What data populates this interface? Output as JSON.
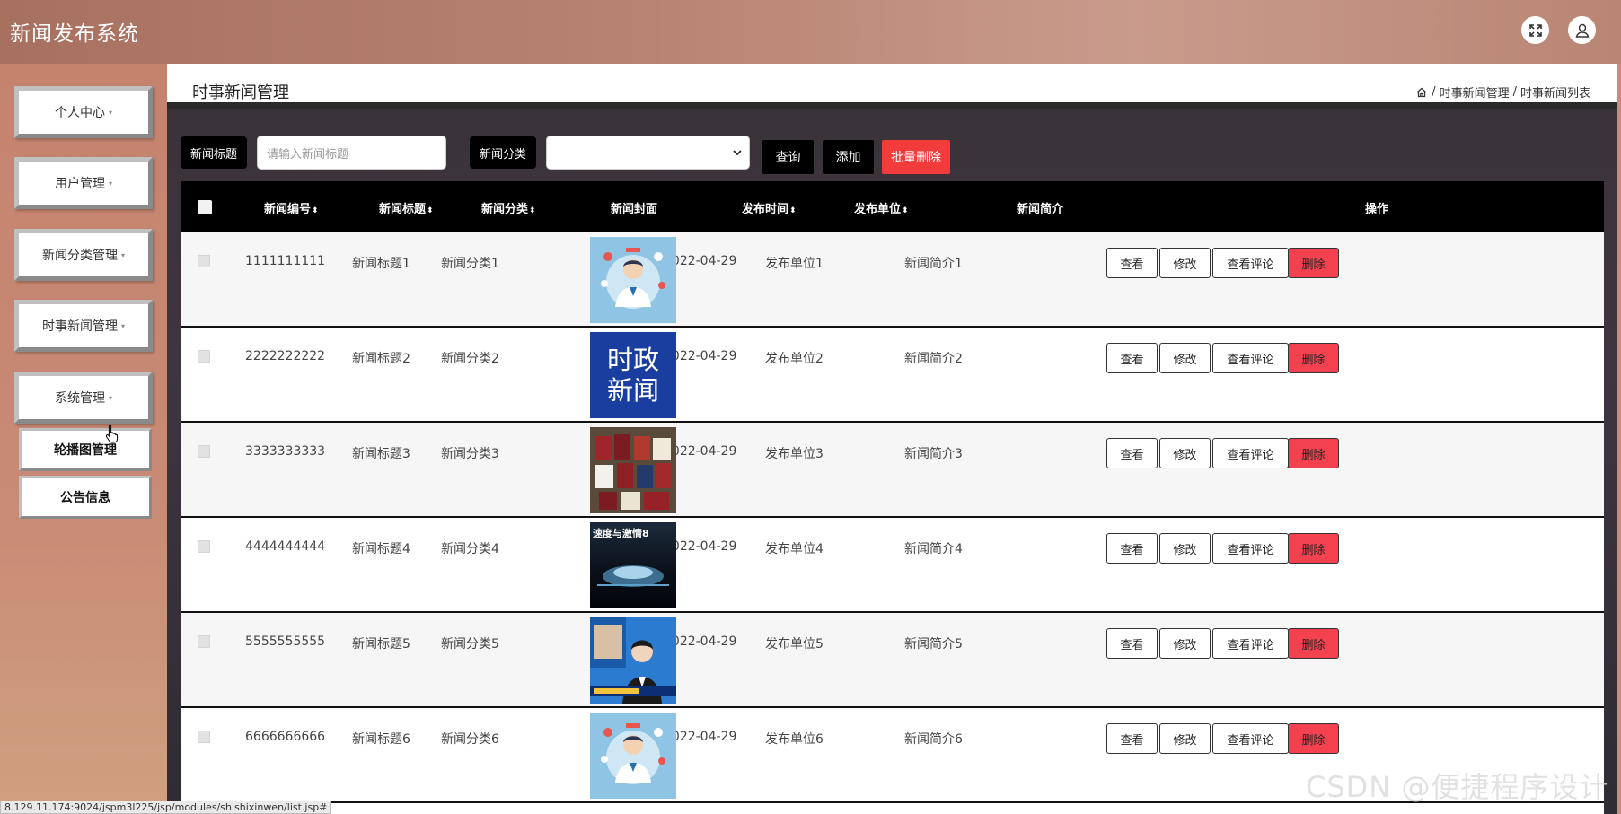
{
  "app": {
    "title": "新闻发布系统"
  },
  "sidebar": {
    "items": [
      {
        "label": "个人中心"
      },
      {
        "label": "用户管理"
      },
      {
        "label": "新闻分类管理"
      },
      {
        "label": "时事新闻管理"
      },
      {
        "label": "系统管理"
      }
    ],
    "sub_items": [
      {
        "label": "轮播图管理"
      },
      {
        "label": "公告信息"
      }
    ]
  },
  "page": {
    "title": "时事新闻管理",
    "breadcrumb": [
      "时事新闻管理",
      "时事新闻列表"
    ],
    "breadcrumb_sep": "/"
  },
  "filter": {
    "title_label": "新闻标题",
    "title_placeholder": "请输入新闻标题",
    "category_label": "新闻分类",
    "category_value": "",
    "query_button": "查询",
    "add_button": "添加",
    "batch_delete_button": "批量删除"
  },
  "table": {
    "headers": {
      "id": "新闻编号",
      "title": "新闻标题",
      "category": "新闻分类",
      "cover": "新闻封面",
      "time": "发布时间",
      "unit": "发布单位",
      "summary": "新闻简介",
      "actions": "操作"
    },
    "sort_glyph": "⬍",
    "actions": {
      "view": "查看",
      "edit": "修改",
      "comments": "查看评论",
      "delete": "删除"
    },
    "rows": [
      {
        "id": "1111111111",
        "title": "新闻标题1",
        "category": "新闻分类1",
        "time": "2022-04-29",
        "unit": "发布单位1",
        "summary": "新闻简介1",
        "cover": "doctor"
      },
      {
        "id": "2222222222",
        "title": "新闻标题2",
        "category": "新闻分类2",
        "time": "2022-04-29",
        "unit": "发布单位2",
        "summary": "新闻简介2",
        "cover": "politics",
        "cover_text": [
          "时政",
          "新闻"
        ]
      },
      {
        "id": "3333333333",
        "title": "新闻标题3",
        "category": "新闻分类3",
        "time": "2022-04-29",
        "unit": "发布单位3",
        "summary": "新闻简介3",
        "cover": "books"
      },
      {
        "id": "4444444444",
        "title": "新闻标题4",
        "category": "新闻分类4",
        "time": "2022-04-29",
        "unit": "发布单位4",
        "summary": "新闻简介4",
        "cover": "movie",
        "cover_text": [
          "速度与激情8"
        ]
      },
      {
        "id": "5555555555",
        "title": "新闻标题5",
        "category": "新闻分类5",
        "time": "2022-04-29",
        "unit": "发布单位5",
        "summary": "新闻简介5",
        "cover": "anchor"
      },
      {
        "id": "6666666666",
        "title": "新闻标题6",
        "category": "新闻分类6",
        "time": "2022-04-29",
        "unit": "发布单位6",
        "summary": "新闻简介6",
        "cover": "doctor"
      }
    ]
  },
  "status_url": "8.129.11.174:9024/jspm3l225/jsp/modules/shishixinwen/list.jsp#",
  "watermark": "CSDN @便捷程序设计",
  "colors": {
    "accent": "#000000",
    "danger": "#f3414f",
    "topbar": "#b88372",
    "sidebar": "#c5836e"
  }
}
